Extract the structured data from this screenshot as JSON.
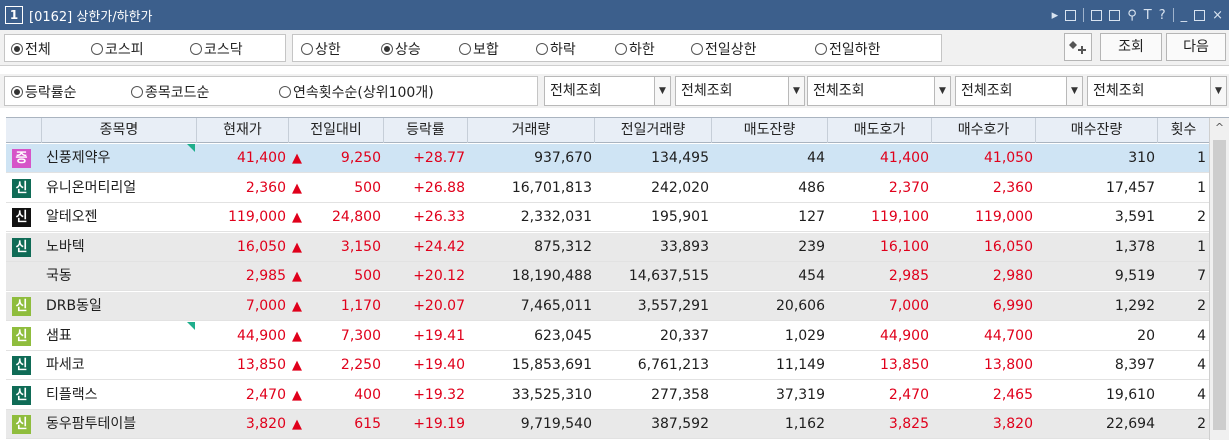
{
  "window": {
    "number": "1",
    "title": "[0162] 상한가/하한가",
    "controls": [
      "▸",
      "T",
      "?",
      "|",
      "_",
      "×"
    ]
  },
  "filters": {
    "market": [
      {
        "label": "전체",
        "selected": true
      },
      {
        "label": "코스피",
        "selected": false
      },
      {
        "label": "코스닥",
        "selected": false
      }
    ],
    "condition": [
      {
        "label": "상한",
        "selected": false
      },
      {
        "label": "상승",
        "selected": true
      },
      {
        "label": "보합",
        "selected": false
      },
      {
        "label": "하락",
        "selected": false
      },
      {
        "label": "하한",
        "selected": false
      },
      {
        "label": "전일상한",
        "selected": false
      },
      {
        "label": "전일하한",
        "selected": false
      }
    ],
    "sort": [
      {
        "label": "등락률순",
        "selected": true
      },
      {
        "label": "종목코드순",
        "selected": false
      },
      {
        "label": "연속횟수순(상위100개)",
        "selected": false
      }
    ],
    "combos": [
      "전체조회",
      "전체조회",
      "전체조회",
      "전체조회",
      "전체조회"
    ]
  },
  "buttons": {
    "query": "조회",
    "next": "다음"
  },
  "icons": {
    "star_button": "add-favorite-icon",
    "scroll_up": "chevron-up-icon"
  },
  "table": {
    "columns": [
      "",
      "종목명",
      "현재가",
      "전일대비",
      "등락률",
      "거래량",
      "전일거래량",
      "매도잔량",
      "매도호가",
      "매수호가",
      "매수잔량",
      "횟수"
    ],
    "rows": [
      {
        "badge": "증",
        "badge_color": "pink",
        "name": "신풍제약우",
        "price": "41,400",
        "change": "9,250",
        "rate": "+28.77",
        "volume": "937,670",
        "prev_volume": "134,495",
        "ask_qty": "44",
        "ask": "41,400",
        "bid": "41,050",
        "bid_qty": "310",
        "count": "1",
        "style": "sel",
        "flag": true
      },
      {
        "badge": "신",
        "badge_color": "green",
        "name": "유니온머티리얼",
        "price": "2,360",
        "change": "500",
        "rate": "+26.88",
        "volume": "16,701,813",
        "prev_volume": "242,020",
        "ask_qty": "486",
        "ask": "2,370",
        "bid": "2,360",
        "bid_qty": "17,457",
        "count": "1",
        "style": "white",
        "flag": false
      },
      {
        "badge": "신",
        "badge_color": "black",
        "name": "알테오젠",
        "price": "119,000",
        "change": "24,800",
        "rate": "+26.33",
        "volume": "2,332,031",
        "prev_volume": "195,901",
        "ask_qty": "127",
        "ask": "119,100",
        "bid": "119,000",
        "bid_qty": "3,591",
        "count": "2",
        "style": "white",
        "flag": false
      },
      {
        "badge": "신",
        "badge_color": "green",
        "name": "노바텍",
        "price": "16,050",
        "change": "3,150",
        "rate": "+24.42",
        "volume": "875,312",
        "prev_volume": "33,893",
        "ask_qty": "239",
        "ask": "16,100",
        "bid": "16,050",
        "bid_qty": "1,378",
        "count": "1",
        "style": "grey",
        "flag": false
      },
      {
        "badge": "",
        "badge_color": "",
        "name": "국동",
        "price": "2,985",
        "change": "500",
        "rate": "+20.12",
        "volume": "18,190,488",
        "prev_volume": "14,637,515",
        "ask_qty": "454",
        "ask": "2,985",
        "bid": "2,980",
        "bid_qty": "9,519",
        "count": "7",
        "style": "grey",
        "flag": false
      },
      {
        "badge": "신",
        "badge_color": "olive",
        "name": "DRB동일",
        "price": "7,000",
        "change": "1,170",
        "rate": "+20.07",
        "volume": "7,465,011",
        "prev_volume": "3,557,291",
        "ask_qty": "20,606",
        "ask": "7,000",
        "bid": "6,990",
        "bid_qty": "1,292",
        "count": "2",
        "style": "grey",
        "flag": false
      },
      {
        "badge": "신",
        "badge_color": "olive",
        "name": "샘표",
        "price": "44,900",
        "change": "7,300",
        "rate": "+19.41",
        "volume": "623,045",
        "prev_volume": "20,337",
        "ask_qty": "1,029",
        "ask": "44,900",
        "bid": "44,700",
        "bid_qty": "20",
        "count": "4",
        "style": "white",
        "flag": true
      },
      {
        "badge": "신",
        "badge_color": "green",
        "name": "파세코",
        "price": "13,850",
        "change": "2,250",
        "rate": "+19.40",
        "volume": "15,853,691",
        "prev_volume": "6,761,213",
        "ask_qty": "11,149",
        "ask": "13,850",
        "bid": "13,800",
        "bid_qty": "8,397",
        "count": "4",
        "style": "white",
        "flag": false
      },
      {
        "badge": "신",
        "badge_color": "green",
        "name": "티플랙스",
        "price": "2,470",
        "change": "400",
        "rate": "+19.32",
        "volume": "33,525,310",
        "prev_volume": "277,358",
        "ask_qty": "37,319",
        "ask": "2,470",
        "bid": "2,465",
        "bid_qty": "19,610",
        "count": "4",
        "style": "white",
        "flag": false
      },
      {
        "badge": "신",
        "badge_color": "olive",
        "name": "동우팜투테이블",
        "price": "3,820",
        "change": "615",
        "rate": "+19.19",
        "volume": "9,719,540",
        "prev_volume": "387,592",
        "ask_qty": "1,162",
        "ask": "3,825",
        "bid": "3,820",
        "bid_qty": "22,694",
        "count": "2",
        "style": "grey",
        "flag": false
      }
    ]
  }
}
